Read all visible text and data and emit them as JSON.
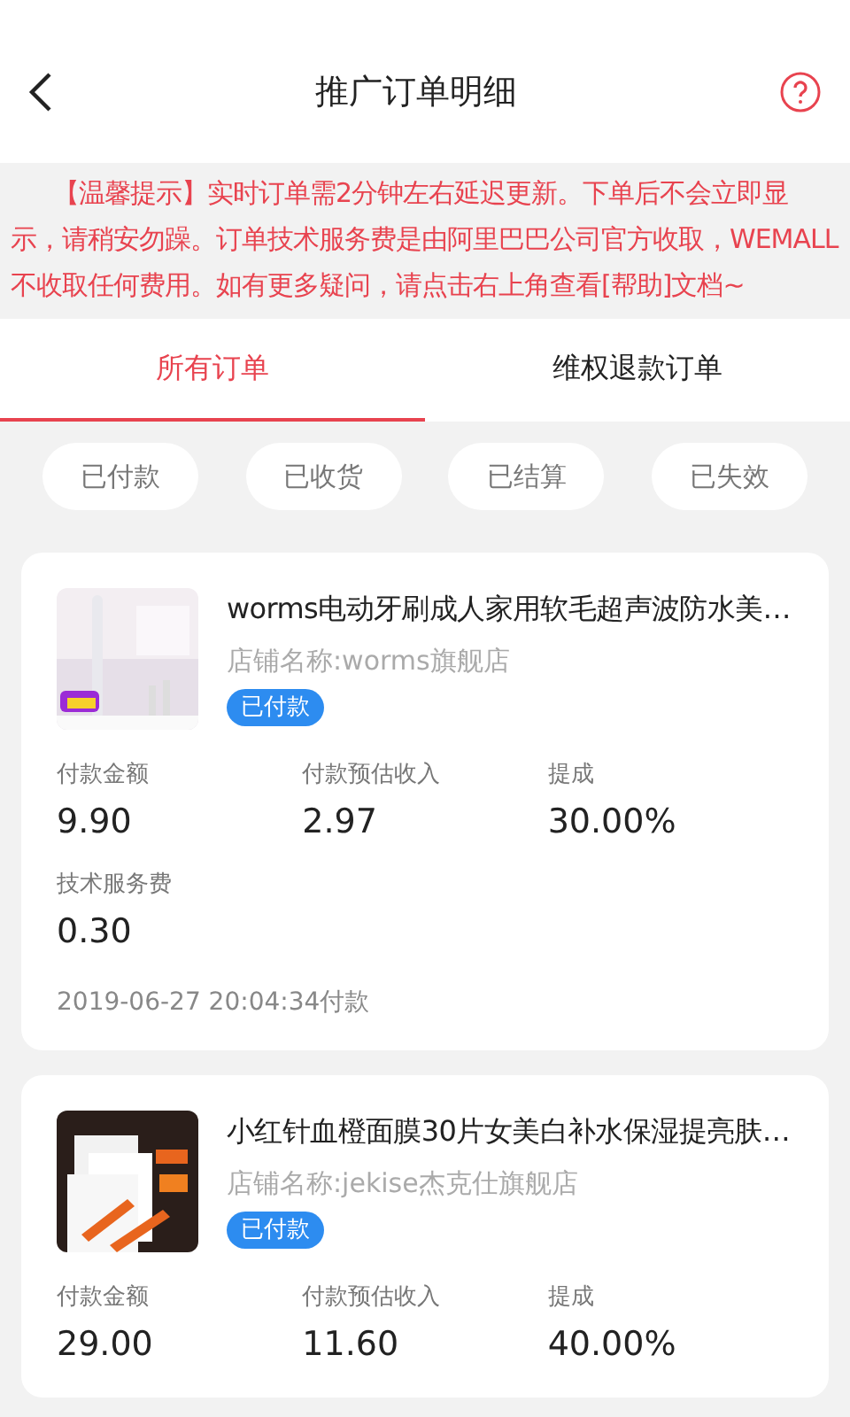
{
  "header": {
    "title": "推广订单明细"
  },
  "notice": "【温馨提示】实时订单需2分钟左右延迟更新。下单后不会立即显示，请稍安勿躁。订单技术服务费是由阿里巴巴公司官方收取，WEMALL不收取任何费用。如有更多疑问，请点击右上角查看[帮助]文档~",
  "tabs": [
    {
      "label": "所有订单",
      "selected": true
    },
    {
      "label": "维权退款订单",
      "selected": false
    }
  ],
  "filters": [
    {
      "label": "已付款",
      "selected": false
    },
    {
      "label": "已收货",
      "selected": false
    },
    {
      "label": "已结算",
      "selected": false
    },
    {
      "label": "已失效",
      "selected": false
    }
  ],
  "orders": [
    {
      "kind": "picture",
      "title": "worms电动牙刷成人家用软毛超声波防水美…",
      "shop": "店铺名称:worms旗舰店",
      "status": "已付款",
      "fields": [
        {
          "label": "付款金额",
          "value": "9.90"
        },
        {
          "label": "付款预估收入",
          "value": "2.97"
        },
        {
          "label": "提成",
          "value": "30.00%"
        },
        {
          "label": "技术服务费",
          "value": "0.30"
        }
      ],
      "time": "2019-06-27 20:04:34付款"
    },
    {
      "kind": "picture",
      "title": "小红针血橙面膜30片女美白补水保湿提亮肤…",
      "shop": "店铺名称:jekise杰克仕旗舰店",
      "status": "已付款",
      "fields": [
        {
          "label": "付款金额",
          "value": "29.00"
        },
        {
          "label": "付款预估收入",
          "value": "11.60"
        },
        {
          "label": "提成",
          "value": "40.00%"
        }
      ]
    }
  ]
}
